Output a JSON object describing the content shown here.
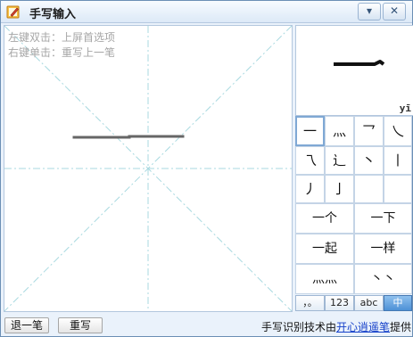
{
  "window": {
    "title": "手写输入",
    "minimize_glyph": "▾",
    "close_glyph": "✕"
  },
  "canvas": {
    "hint_line1": "左键双击：上屏首选项",
    "hint_line2": "右键单击：重写上一笔"
  },
  "preview": {
    "character": "一",
    "pinyin": "yī"
  },
  "candidates_single": [
    "一",
    "灬",
    "乛",
    "乀",
    "乁",
    "辶",
    "丶",
    "丨",
    "丿",
    "亅",
    "",
    ""
  ],
  "candidates_words": [
    "一个",
    "一下",
    "一起",
    "一样",
    "灬灬",
    "丶丶"
  ],
  "tabs": [
    {
      "label": "，。",
      "active": false
    },
    {
      "label": "123",
      "active": false
    },
    {
      "label": "abc",
      "active": false
    },
    {
      "label": "中",
      "active": true
    }
  ],
  "bottom": {
    "undo_label": "退一笔",
    "rewrite_label": "重写",
    "credit_prefix": "手写识别技术由",
    "credit_link": "开心逍遥笔",
    "credit_suffix": "提供"
  },
  "colors": {
    "accent": "#4d91d6",
    "guide": "#a9d9e0",
    "stroke": "#666666",
    "link": "#1540c9"
  }
}
